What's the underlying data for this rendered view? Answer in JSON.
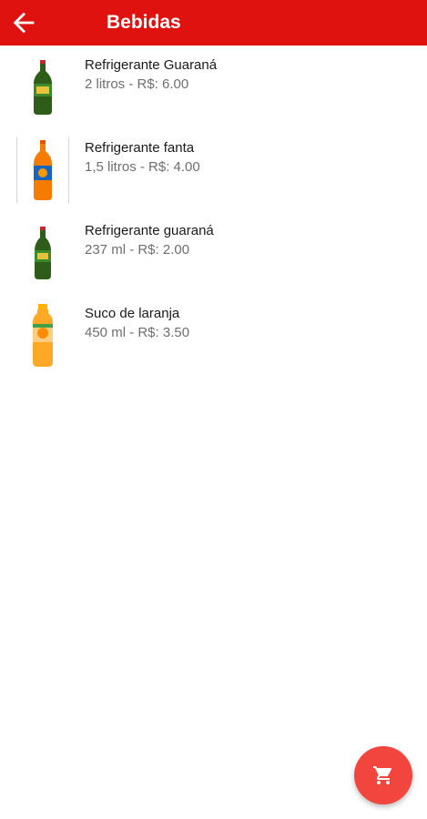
{
  "header": {
    "title": "Bebidas",
    "back_icon": "arrow-back-icon",
    "color": "#e0120f"
  },
  "products": [
    {
      "name": "Refrigerante Guaraná",
      "detail": "2 litros - R$: 6.00",
      "image": "green-soda-bottle"
    },
    {
      "name": "Refrigerante fanta",
      "detail": "1,5 litros - R$: 4.00",
      "image": "orange-soda-bottle"
    },
    {
      "name": "Refrigerante guaraná",
      "detail": "237 ml - R$: 2.00",
      "image": "small-green-soda-bottle"
    },
    {
      "name": "Suco de laranja",
      "detail": "450 ml - R$: 3.50",
      "image": "orange-juice-bottle"
    }
  ],
  "fab": {
    "icon": "cart-icon",
    "color": "#f2453d"
  }
}
